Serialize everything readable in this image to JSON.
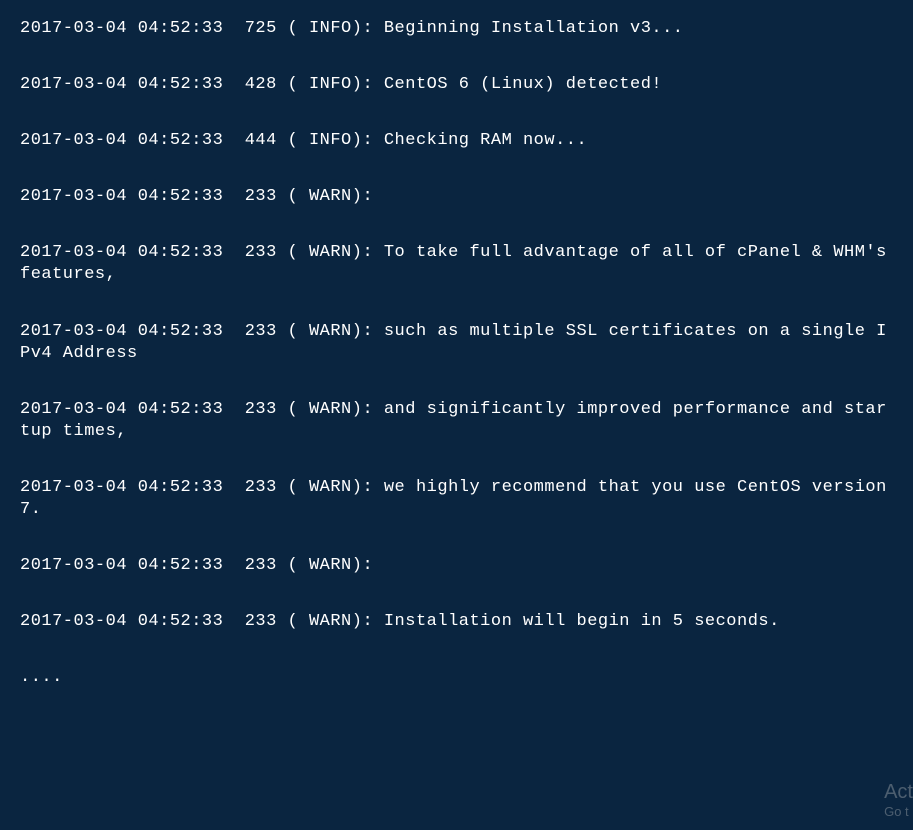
{
  "terminal": {
    "lines": [
      "2017-03-04 04:52:33  725 ( INFO): Beginning Installation v3...",
      "2017-03-04 04:52:33  428 ( INFO): CentOS 6 (Linux) detected!",
      "2017-03-04 04:52:33  444 ( INFO): Checking RAM now...",
      "2017-03-04 04:52:33  233 ( WARN):",
      "2017-03-04 04:52:33  233 ( WARN): To take full advantage of all of cPanel & WHM's features,",
      "2017-03-04 04:52:33  233 ( WARN): such as multiple SSL certificates on a single IPv4 Address",
      "2017-03-04 04:52:33  233 ( WARN): and significantly improved performance and startup times,",
      "2017-03-04 04:52:33  233 ( WARN): we highly recommend that you use CentOS version 7.",
      "2017-03-04 04:52:33  233 ( WARN):",
      "2017-03-04 04:52:33  233 ( WARN): Installation will begin in 5 seconds.",
      "...."
    ]
  },
  "watermark": {
    "line1": "Act",
    "line2": "Go t"
  }
}
